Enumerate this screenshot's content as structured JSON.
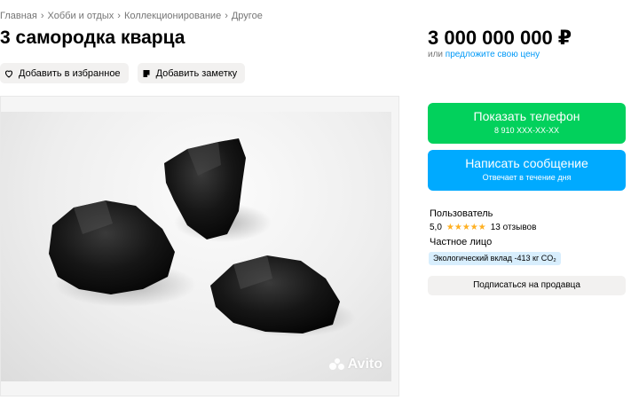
{
  "breadcrumbs": [
    "Главная",
    "Хобби и отдых",
    "Коллекционирование",
    "Другое"
  ],
  "title": "3 самородка кварца",
  "actions": {
    "favorite_label": "Добавить в избранное",
    "note_label": "Добавить заметку"
  },
  "photo": {
    "watermark": "Avito",
    "description": "photo-of-three-black-stones"
  },
  "price": {
    "value": "3 000 000 000 ₽",
    "offer_prefix": "или",
    "offer_link": "предложите свою цену"
  },
  "buttons": {
    "phone_label": "Показать телефон",
    "phone_number": "8 910 XXX-XX-XX",
    "message_label": "Написать сообщение",
    "message_sub": "Отвечает в течение дня"
  },
  "seller": {
    "name": "Пользователь",
    "rating": "5,0",
    "stars": "★★★★★",
    "reviews": "13 отзывов",
    "type": "Частное лицо",
    "eco_badge": "Экологический вклад -413 кг CO₂",
    "subscribe_label": "Подписаться на продавца"
  },
  "colors": {
    "green": "#02d15c",
    "blue": "#00aaff",
    "link": "#0099f7",
    "star": "#ffb021"
  }
}
